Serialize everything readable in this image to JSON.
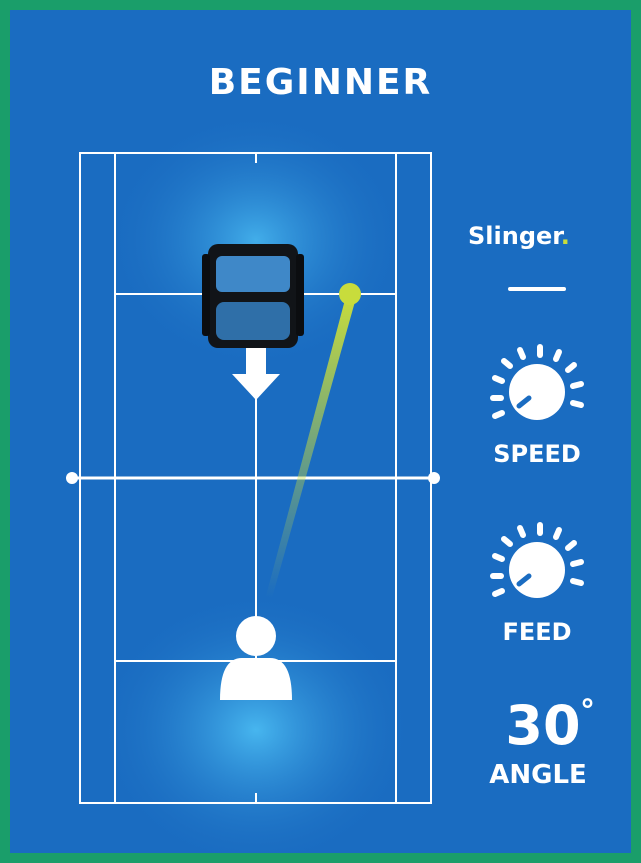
{
  "title": "BEGINNER",
  "brand": {
    "logo_text": "Slinger",
    "logo_dot": ".",
    "accent_color": "#c8dc3c"
  },
  "controls": {
    "speed": {
      "label": "SPEED",
      "icon": "dial-icon"
    },
    "feed": {
      "label": "FEED",
      "icon": "dial-icon"
    },
    "angle": {
      "value": "30",
      "unit": "°",
      "label": "ANGLE"
    }
  },
  "colors": {
    "background": "#1a6cc1",
    "border": "#1a9e6a",
    "court_lines": "#ffffff",
    "ball": "#c8dc3c"
  },
  "icons": {
    "machine": "ball-machine-icon",
    "direction": "arrow-down-icon",
    "player": "player-icon",
    "ball": "tennis-ball-icon"
  }
}
